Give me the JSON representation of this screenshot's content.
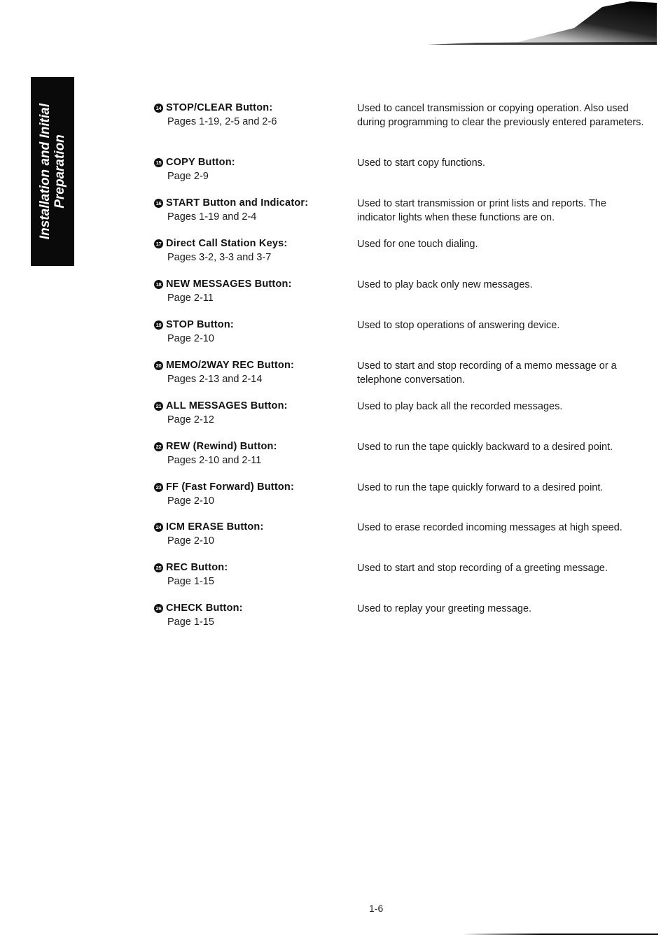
{
  "side_tab": {
    "line1": "Installation and Initial",
    "line2": "Preparation"
  },
  "entries": [
    {
      "number": "14",
      "title": "STOP/CLEAR Button:",
      "pages": "Pages 1-19, 2-5 and 2-6",
      "description": "Used to cancel transmission or copying operation. Also used during programming to clear the previously entered parameters."
    },
    {
      "number": "15",
      "title": "COPY Button:",
      "pages": "Page 2-9",
      "description": "Used to start copy functions."
    },
    {
      "number": "16",
      "title": "START Button and Indicator:",
      "pages": "Pages 1-19 and 2-4",
      "description": "Used to start transmission or print lists and reports. The indicator lights when these functions are on."
    },
    {
      "number": "17",
      "title": "Direct Call Station Keys:",
      "pages": "Pages 3-2, 3-3 and 3-7",
      "description": "Used for one touch dialing."
    },
    {
      "number": "18",
      "title": "NEW MESSAGES Button:",
      "pages": "Page 2-11",
      "description": "Used to play back only new messages."
    },
    {
      "number": "19",
      "title": "STOP Button:",
      "pages": "Page 2-10",
      "description": "Used to stop operations of answering device."
    },
    {
      "number": "20",
      "title": "MEMO/2WAY REC Button:",
      "pages": "Pages 2-13 and 2-14",
      "description": "Used to start and stop recording of a memo message or a telephone conversation."
    },
    {
      "number": "21",
      "title": "ALL MESSAGES Button:",
      "pages": "Page 2-12",
      "description": "Used to play back all the recorded messages."
    },
    {
      "number": "22",
      "title": "REW (Rewind) Button:",
      "pages": "Pages 2-10 and 2-11",
      "description": "Used to run the tape quickly backward to a desired point."
    },
    {
      "number": "23",
      "title": "FF (Fast Forward) Button:",
      "pages": "Page 2-10",
      "description": "Used to run the tape quickly forward to a desired point."
    },
    {
      "number": "24",
      "title": "ICM ERASE Button:",
      "pages": "Page 2-10",
      "description": "Used to erase recorded incoming messages at high speed."
    },
    {
      "number": "25",
      "title": "REC Button:",
      "pages": "Page 1-15",
      "description": "Used to start and stop recording of a greeting message."
    },
    {
      "number": "26",
      "title": "CHECK Button:",
      "pages": "Page 1-15",
      "description": "Used to replay your greeting message."
    }
  ],
  "footer": {
    "page_number": "1-6"
  }
}
